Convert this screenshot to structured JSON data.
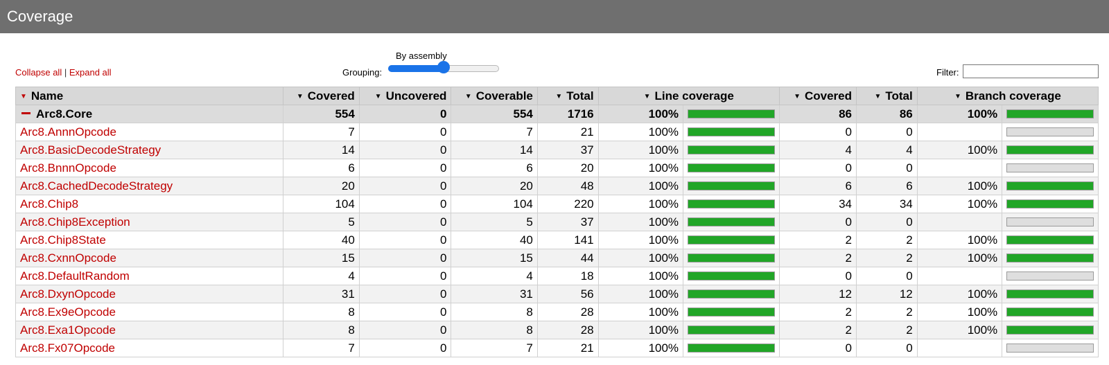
{
  "header": {
    "title": "Coverage"
  },
  "controls": {
    "collapse_all": "Collapse all",
    "separator": "|",
    "expand_all": "Expand all",
    "grouping_label": "Grouping:",
    "slider_value_label": "By assembly",
    "slider_level": 0.5,
    "filter_label": "Filter:",
    "filter_value": ""
  },
  "columns": {
    "name": "Name",
    "covered": "Covered",
    "uncovered": "Uncovered",
    "coverable": "Coverable",
    "total": "Total",
    "line_coverage": "Line coverage",
    "branch_covered": "Covered",
    "branch_total": "Total",
    "branch_coverage": "Branch coverage"
  },
  "assembly": {
    "name": "Arc8.Core",
    "covered": "554",
    "uncovered": "0",
    "coverable": "554",
    "total": "1716",
    "line_pct": "100%",
    "line_fraction": 1.0,
    "branch_covered": "86",
    "branch_total": "86",
    "branch_pct": "100%",
    "branch_fraction": 1.0
  },
  "classes": [
    {
      "name": "Arc8.AnnnOpcode",
      "covered": "7",
      "uncovered": "0",
      "coverable": "7",
      "total": "21",
      "line_pct": "100%",
      "line_fraction": 1.0,
      "branch_covered": "0",
      "branch_total": "0",
      "branch_pct": "",
      "branch_fraction": 0
    },
    {
      "name": "Arc8.BasicDecodeStrategy",
      "covered": "14",
      "uncovered": "0",
      "coverable": "14",
      "total": "37",
      "line_pct": "100%",
      "line_fraction": 1.0,
      "branch_covered": "4",
      "branch_total": "4",
      "branch_pct": "100%",
      "branch_fraction": 1.0
    },
    {
      "name": "Arc8.BnnnOpcode",
      "covered": "6",
      "uncovered": "0",
      "coverable": "6",
      "total": "20",
      "line_pct": "100%",
      "line_fraction": 1.0,
      "branch_covered": "0",
      "branch_total": "0",
      "branch_pct": "",
      "branch_fraction": 0
    },
    {
      "name": "Arc8.CachedDecodeStrategy",
      "covered": "20",
      "uncovered": "0",
      "coverable": "20",
      "total": "48",
      "line_pct": "100%",
      "line_fraction": 1.0,
      "branch_covered": "6",
      "branch_total": "6",
      "branch_pct": "100%",
      "branch_fraction": 1.0
    },
    {
      "name": "Arc8.Chip8",
      "covered": "104",
      "uncovered": "0",
      "coverable": "104",
      "total": "220",
      "line_pct": "100%",
      "line_fraction": 1.0,
      "branch_covered": "34",
      "branch_total": "34",
      "branch_pct": "100%",
      "branch_fraction": 1.0
    },
    {
      "name": "Arc8.Chip8Exception",
      "covered": "5",
      "uncovered": "0",
      "coverable": "5",
      "total": "37",
      "line_pct": "100%",
      "line_fraction": 1.0,
      "branch_covered": "0",
      "branch_total": "0",
      "branch_pct": "",
      "branch_fraction": 0
    },
    {
      "name": "Arc8.Chip8State",
      "covered": "40",
      "uncovered": "0",
      "coverable": "40",
      "total": "141",
      "line_pct": "100%",
      "line_fraction": 1.0,
      "branch_covered": "2",
      "branch_total": "2",
      "branch_pct": "100%",
      "branch_fraction": 1.0
    },
    {
      "name": "Arc8.CxnnOpcode",
      "covered": "15",
      "uncovered": "0",
      "coverable": "15",
      "total": "44",
      "line_pct": "100%",
      "line_fraction": 1.0,
      "branch_covered": "2",
      "branch_total": "2",
      "branch_pct": "100%",
      "branch_fraction": 1.0
    },
    {
      "name": "Arc8.DefaultRandom",
      "covered": "4",
      "uncovered": "0",
      "coverable": "4",
      "total": "18",
      "line_pct": "100%",
      "line_fraction": 1.0,
      "branch_covered": "0",
      "branch_total": "0",
      "branch_pct": "",
      "branch_fraction": 0
    },
    {
      "name": "Arc8.DxynOpcode",
      "covered": "31",
      "uncovered": "0",
      "coverable": "31",
      "total": "56",
      "line_pct": "100%",
      "line_fraction": 1.0,
      "branch_covered": "12",
      "branch_total": "12",
      "branch_pct": "100%",
      "branch_fraction": 1.0
    },
    {
      "name": "Arc8.Ex9eOpcode",
      "covered": "8",
      "uncovered": "0",
      "coverable": "8",
      "total": "28",
      "line_pct": "100%",
      "line_fraction": 1.0,
      "branch_covered": "2",
      "branch_total": "2",
      "branch_pct": "100%",
      "branch_fraction": 1.0
    },
    {
      "name": "Arc8.Exa1Opcode",
      "covered": "8",
      "uncovered": "0",
      "coverable": "8",
      "total": "28",
      "line_pct": "100%",
      "line_fraction": 1.0,
      "branch_covered": "2",
      "branch_total": "2",
      "branch_pct": "100%",
      "branch_fraction": 1.0
    },
    {
      "name": "Arc8.Fx07Opcode",
      "covered": "7",
      "uncovered": "0",
      "coverable": "7",
      "total": "21",
      "line_pct": "100%",
      "line_fraction": 1.0,
      "branch_covered": "0",
      "branch_total": "0",
      "branch_pct": "",
      "branch_fraction": 0
    }
  ],
  "colors": {
    "header_bg": "#6f6f6f",
    "link": "#c00000",
    "bar_fill": "#21a627",
    "bar_empty": "#dedede",
    "slider_accent": "#1a73e8"
  }
}
